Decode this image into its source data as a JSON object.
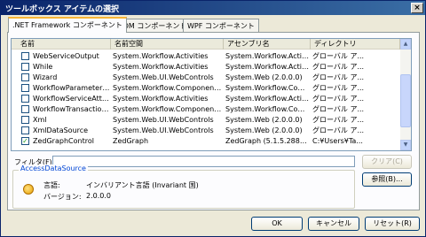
{
  "window": {
    "title": "ツールボックス アイテムの選択",
    "close_glyph": "×"
  },
  "tabs": [
    {
      "label": ".NET Framework コンポーネント",
      "active": true
    },
    {
      "label": "COM コンポーネント",
      "active": false
    },
    {
      "label": "WPF コンポーネント",
      "active": false
    }
  ],
  "columns": [
    "名前",
    "名前空間",
    "アセンブリ名",
    "ディレクトリ"
  ],
  "rows": [
    {
      "checked": false,
      "name": "WebServiceOutput",
      "namespace": "System.Workflow.Activities",
      "assembly": "System.Workflow.Activi...",
      "directory": "グローバル ア..."
    },
    {
      "checked": false,
      "name": "While",
      "namespace": "System.Workflow.Activities",
      "assembly": "System.Workflow.Activi...",
      "directory": "グローバル ア..."
    },
    {
      "checked": false,
      "name": "Wizard",
      "namespace": "System.Web.UI.WebControls",
      "assembly": "System.Web (2.0.0.0)",
      "directory": "グローバル ア..."
    },
    {
      "checked": false,
      "name": "WorkflowParameterBi...",
      "namespace": "System.Workflow.ComponentM...",
      "assembly": "System.Workflow.Comp...",
      "directory": "グローバル ア..."
    },
    {
      "checked": false,
      "name": "WorkflowServiceAttri...",
      "namespace": "System.Workflow.Activities",
      "assembly": "System.Workflow.Activi...",
      "directory": "グローバル ア..."
    },
    {
      "checked": false,
      "name": "WorkflowTransaction...",
      "namespace": "System.Workflow.ComponentM...",
      "assembly": "System.Workflow.Comp...",
      "directory": "グローバル ア..."
    },
    {
      "checked": false,
      "name": "Xml",
      "namespace": "System.Web.UI.WebControls",
      "assembly": "System.Web (2.0.0.0)",
      "directory": "グローバル ア..."
    },
    {
      "checked": false,
      "name": "XmlDataSource",
      "namespace": "System.Web.UI.WebControls",
      "assembly": "System.Web (2.0.0.0)",
      "directory": "グローバル ア..."
    },
    {
      "checked": true,
      "name": "ZedGraphControl",
      "namespace": "ZedGraph",
      "assembly": "ZedGraph (5.1.5.28844)",
      "directory": "C:¥Users¥Ta..."
    }
  ],
  "filter": {
    "label": "フィルタ(F):",
    "value": "",
    "clear_label": "クリア(C)"
  },
  "details": {
    "group_title": "AccessDataSource",
    "language_label": "言語:",
    "language_value": "インバリアント言語 (Invariant 国)",
    "version_label": "バージョン:",
    "version_value": "2.0.0.0",
    "icon": "globe-icon"
  },
  "browse_label": "参照(B)...",
  "footer": {
    "ok_label": "OK",
    "cancel_label": "キャンセル",
    "reset_label": "リセット(R)"
  },
  "scroll": {
    "up_glyph": "▲",
    "down_glyph": "▼"
  }
}
